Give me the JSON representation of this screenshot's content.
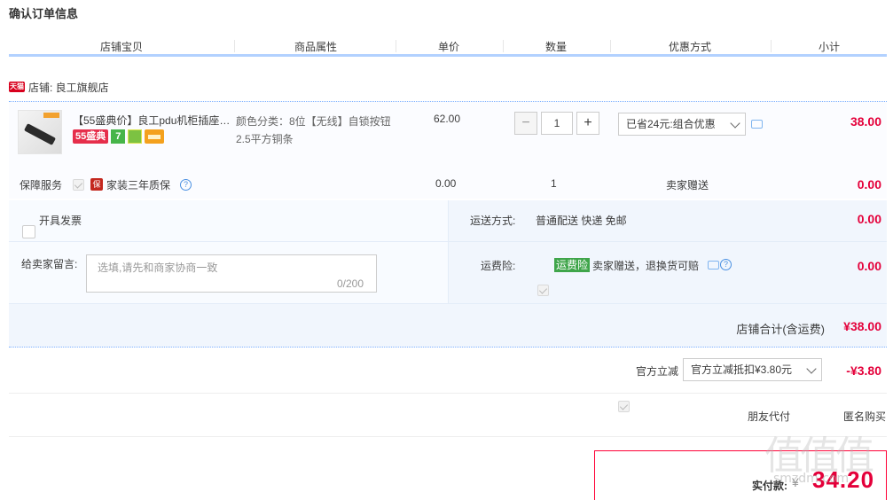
{
  "page_title": "确认订单信息",
  "columns": [
    "店铺宝贝",
    "商品属性",
    "单价",
    "数量",
    "优惠方式",
    "小计"
  ],
  "shop": {
    "badge": "天猫",
    "label": "店铺: 良工旗舰店"
  },
  "item": {
    "title": "【55盛典价】良工pdu机柜插座…",
    "badge_55": "55盛典",
    "badge_7": "7",
    "sku_line1": "颜色分类：8位【无线】自锁按钮",
    "sku_line2": "2.5平方铜条",
    "price": "62.00",
    "quantity": "1",
    "promo": "已省24元:组合优惠",
    "subtotal": "38.00"
  },
  "guarantee": {
    "label": "保障服务",
    "badge": "保",
    "name": "家装三年质保",
    "price": "0.00",
    "qty": "1",
    "promo": "卖家赠送",
    "subtotal": "0.00"
  },
  "invoice": {
    "label": "开具发票"
  },
  "shipping": {
    "label": "运送方式:",
    "value": "普通配送 快递 免邮",
    "subtotal": "0.00"
  },
  "message": {
    "label": "给卖家留言:",
    "placeholder": "选填,请先和商家协商一致",
    "count": "0/200"
  },
  "insurance": {
    "label": "运费险:",
    "tag": "运费险",
    "desc": "卖家赠送，退换货可赔",
    "subtotal": "0.00"
  },
  "shop_total": {
    "label": "店铺合计(含运费)",
    "value": "¥38.00"
  },
  "official": {
    "label": "官方立减",
    "select": "官方立减抵扣¥3.80元",
    "value": "-¥3.80"
  },
  "options": {
    "friend_pay": "朋友代付",
    "anonymous": "匿名购买"
  },
  "pay": {
    "label": "实付款:",
    "yen": "¥",
    "amount": "34.20"
  },
  "watermark": {
    "text": "值值值",
    "url": "smzdm.com"
  }
}
